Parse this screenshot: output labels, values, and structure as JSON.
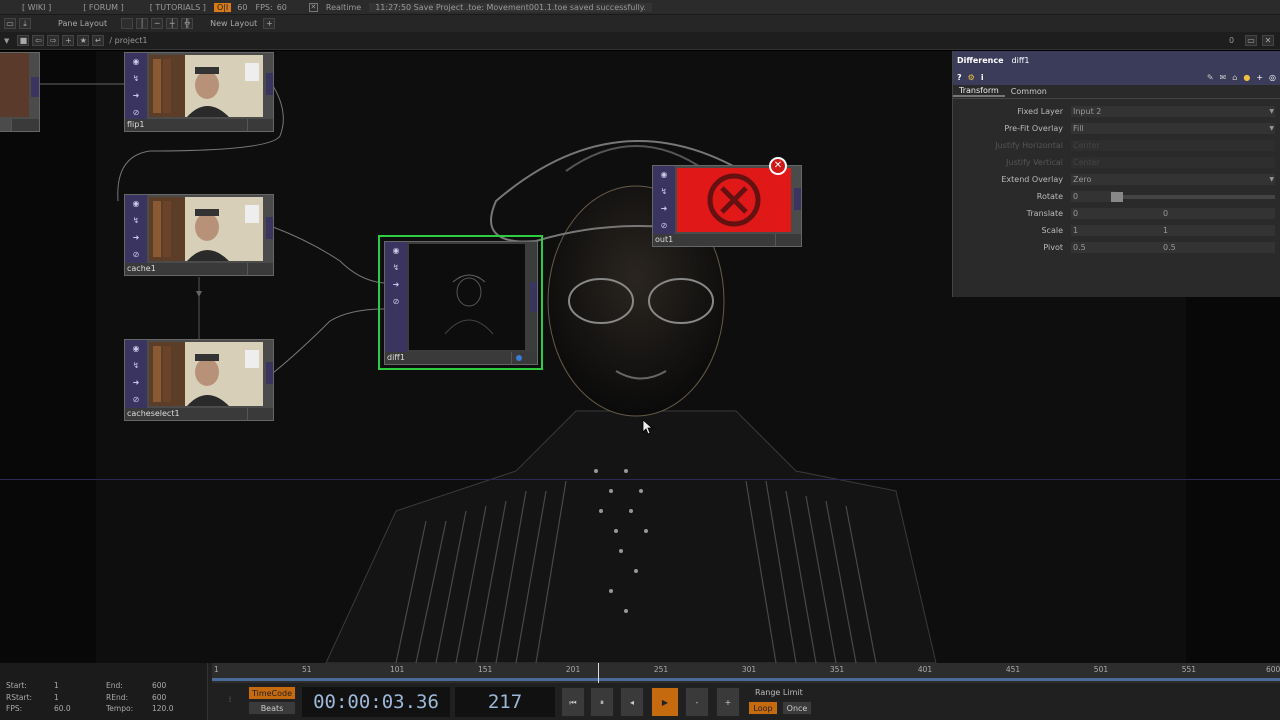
{
  "menubar": {
    "wiki": "[ WIKI ]",
    "forum": "[ FORUM ]",
    "tutorials": "[ TUTORIALS ]",
    "oi": "O|I",
    "fps_set": "60",
    "fps_label": "FPS:",
    "fps_value": "60",
    "realtime": "Realtime",
    "status": "11:27:50 Save Project .toe: Movement001.1.toe saved successfully."
  },
  "toolbar": {
    "pane_layout": "Pane Layout",
    "new_layout": "New Layout",
    "plus": "+"
  },
  "pathbar": {
    "path": "/ project1",
    "count": "0"
  },
  "nodes": {
    "flip1": "flip1",
    "cache1": "cache1",
    "cacheselect1": "cacheselect1",
    "diff1": "diff1",
    "out1": "out1"
  },
  "params": {
    "op_type": "Difference",
    "op_name": "diff1",
    "tabs": [
      "Transform",
      "Common"
    ],
    "rows": [
      {
        "label": "Fixed Layer",
        "value": "Input 2"
      },
      {
        "label": "Pre-Fit Overlay",
        "value": "Fill"
      },
      {
        "label": "Justify Horizontal",
        "value": "Center"
      },
      {
        "label": "Justify Vertical",
        "value": "Center"
      },
      {
        "label": "Extend Overlay",
        "value": "Zero"
      },
      {
        "label": "Rotate",
        "value": "0"
      },
      {
        "label": "Translate",
        "value": "0",
        "value2": "0"
      },
      {
        "label": "Scale",
        "value": "1",
        "value2": "1"
      },
      {
        "label": "Pivot",
        "value": "0.5",
        "value2": "0.5"
      }
    ]
  },
  "timeline": {
    "start_l": "Start:",
    "start": "1",
    "end_l": "End:",
    "end": "600",
    "rstart_l": "RStart:",
    "rstart": "1",
    "rend_l": "REnd:",
    "rend": "600",
    "fps_l": "FPS:",
    "fps": "60.0",
    "tempo_l": "Tempo:",
    "tempo": "120.0",
    "ticks": [
      "1",
      "51",
      "101",
      "151",
      "201",
      "251",
      "301",
      "351",
      "401",
      "451",
      "501",
      "551",
      "600"
    ],
    "timecode_btn": "TimeCode",
    "beats_btn": "Beats",
    "timecode": "00:00:03.36",
    "frame": "217",
    "range_limit": "Range Limit",
    "loop": "Loop",
    "once": "Once",
    "minus": "-",
    "plus": "+"
  },
  "colors": {
    "node_side": "#3a3560",
    "selected": "#2ecc40",
    "accent": "#c66a10"
  }
}
